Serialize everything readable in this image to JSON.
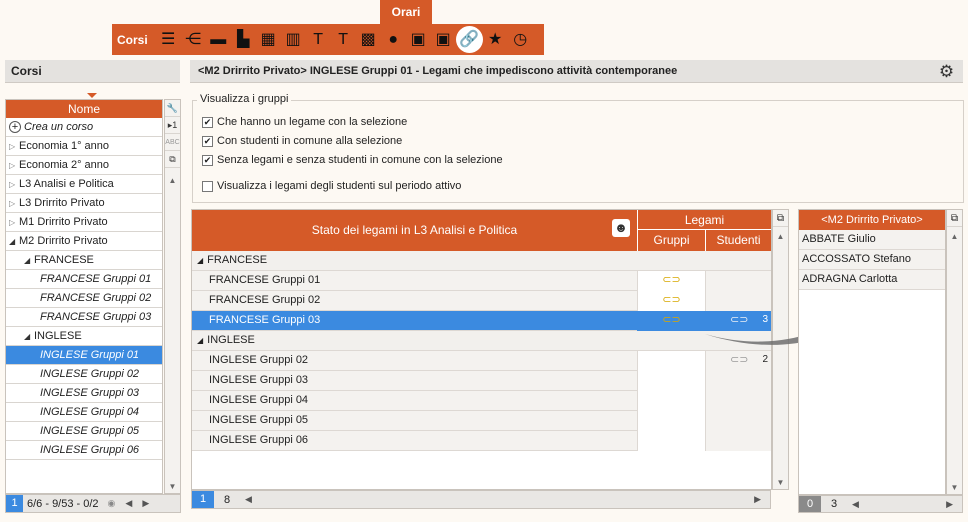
{
  "toolbar": {
    "tab_label": "Orari",
    "section_label": "Corsi",
    "icons": [
      "list-icon",
      "hierarchy-icon",
      "groups-icon",
      "timetable-icon",
      "grid-icon",
      "calendar-icon",
      "time-icon",
      "time-delete-icon",
      "people-grid-icon",
      "student-icon",
      "teacher-card-icon",
      "person-card-icon",
      "link-icon",
      "star-icon",
      "clock-icon"
    ],
    "glyphs": [
      "☰",
      "⋲",
      "▬",
      "▙",
      "▦",
      "▥",
      "T",
      "T",
      "▩",
      "●",
      "▣",
      "▣",
      "🔗",
      "★",
      "◷"
    ]
  },
  "left": {
    "header": "Corsi",
    "column": "Nome",
    "create": "Crea un corso",
    "rows": [
      {
        "label": "Economia 1° anno",
        "indent": 0,
        "type": "closed"
      },
      {
        "label": "Economia 2° anno",
        "indent": 0,
        "type": "closed"
      },
      {
        "label": "L3 Analisi e Politica",
        "indent": 0,
        "type": "closed"
      },
      {
        "label": "L3 Drirrito Privato",
        "indent": 0,
        "type": "closed"
      },
      {
        "label": "M1 Drirrito Privato",
        "indent": 0,
        "type": "closed"
      },
      {
        "label": "M2 Drirrito Privato",
        "indent": 0,
        "type": "open"
      },
      {
        "label": "FRANCESE",
        "indent": 1,
        "type": "open"
      },
      {
        "label": "FRANCESE Gruppi  01",
        "indent": 2,
        "type": "leaf"
      },
      {
        "label": "FRANCESE Gruppi  02",
        "indent": 2,
        "type": "leaf"
      },
      {
        "label": "FRANCESE Gruppi  03",
        "indent": 2,
        "type": "leaf"
      },
      {
        "label": "INGLESE",
        "indent": 1,
        "type": "open"
      },
      {
        "label": "INGLESE Gruppi  01",
        "indent": 2,
        "type": "leaf",
        "selected": true
      },
      {
        "label": "INGLESE Gruppi  02",
        "indent": 2,
        "type": "leaf"
      },
      {
        "label": "INGLESE Gruppi  03",
        "indent": 2,
        "type": "leaf"
      },
      {
        "label": "INGLESE Gruppi  04",
        "indent": 2,
        "type": "leaf"
      },
      {
        "label": "INGLESE Gruppi  05",
        "indent": 2,
        "type": "leaf"
      },
      {
        "label": "INGLESE Gruppi  06",
        "indent": 2,
        "type": "leaf"
      }
    ],
    "footer": {
      "page": "1",
      "count": "6/6 - 9/53 - 0/2"
    }
  },
  "main": {
    "title": "<M2 Drirrito Privato> INGLESE Gruppi  01 - Legami che impediscono attività contemporanee",
    "filter_legend": "Visualizza i gruppi",
    "checks": [
      {
        "label": "Che hanno un legame con la selezione",
        "checked": true
      },
      {
        "label": "Con studenti in comune alla selezione",
        "checked": true
      },
      {
        "label": "Senza legami e senza studenti in comune con la selezione",
        "checked": true
      },
      {
        "label": "Visualizza i legami degli studenti sul periodo attivo",
        "checked": false
      }
    ]
  },
  "stato": {
    "title": "Stato dei legami in L3 Analisi e Politica",
    "legami": "Legami",
    "col_gruppi": "Gruppi",
    "col_studenti": "Studenti",
    "rows": [
      {
        "label": "FRANCESE",
        "group": true
      },
      {
        "label": "FRANCESE Gruppi  01",
        "gruppi": true,
        "studenti": ""
      },
      {
        "label": "FRANCESE Gruppi  02",
        "gruppi": true,
        "studenti": ""
      },
      {
        "label": "FRANCESE Gruppi  03",
        "gruppi": true,
        "studenti": "3",
        "selected": true
      },
      {
        "label": "INGLESE",
        "group": true
      },
      {
        "label": "INGLESE Gruppi  02",
        "gruppi": false,
        "studenti": "2"
      },
      {
        "label": "INGLESE Gruppi  03",
        "gruppi": false,
        "studenti": ""
      },
      {
        "label": "INGLESE Gruppi  04",
        "gruppi": false,
        "studenti": ""
      },
      {
        "label": "INGLESE Gruppi  05",
        "gruppi": false,
        "studenti": ""
      },
      {
        "label": "INGLESE Gruppi  06",
        "gruppi": false,
        "studenti": ""
      }
    ],
    "footer": {
      "page": "1",
      "count": "8"
    }
  },
  "students": {
    "header": "<M2 Drirrito Privato>",
    "rows": [
      "ABBATE Giulio",
      "ACCOSSATO Stefano",
      "ADRAGNA Carlotta"
    ],
    "footer": {
      "page": "0",
      "count": "3"
    }
  },
  "colors": {
    "accent": "#d55a28",
    "selection": "#3b8ae0",
    "link_gold": "#d8a800"
  }
}
